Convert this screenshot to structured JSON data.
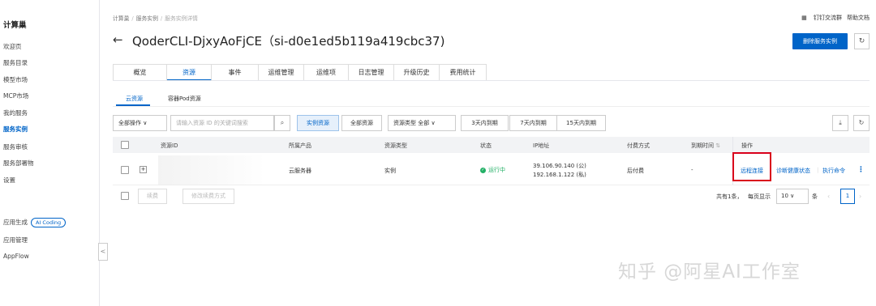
{
  "sidebar": {
    "brand": "计算巢",
    "items": [
      {
        "label": "欢迎页"
      },
      {
        "label": "服务目录"
      },
      {
        "label": "模型市场"
      },
      {
        "label": "MCP市场"
      },
      {
        "label": "我的服务"
      },
      {
        "label": "服务实例"
      },
      {
        "label": "服务审核"
      },
      {
        "label": "服务部署物"
      },
      {
        "label": "设置"
      }
    ],
    "group2": [
      {
        "label": "应用生成",
        "badge": "AI Coding"
      },
      {
        "label": "应用管理"
      },
      {
        "label": "AppFlow"
      }
    ],
    "collapse_glyph": "<"
  },
  "header": {
    "breadcrumb": [
      "计算巢",
      "服务实例",
      "服务实例详情"
    ],
    "links": [
      "钉钉交流群",
      "帮助文档"
    ],
    "title": "QoderCLI-DjxyAoFjCE（si-d0e1ed5b119a419cbc37)",
    "delete_button": "删除服务实例"
  },
  "tabs": [
    "概览",
    "资源",
    "事件",
    "运维管理",
    "运维项",
    "日志管理",
    "升级历史",
    "费用统计"
  ],
  "subtabs": [
    "云资源",
    "容器Pod资源"
  ],
  "filters": {
    "all_actions": "全部操作",
    "search_placeholder": "请输入资源 ID 的关键词搜索",
    "instance_resource": "实例资源",
    "all_resource": "全部资源",
    "resource_type": "资源类型  全部",
    "expire_3": "3天内到期",
    "expire_7": "7天内到期",
    "expire_15": "15天内到期"
  },
  "table": {
    "columns": [
      "资源ID",
      "所属产品",
      "资源类型",
      "状态",
      "IP地址",
      "付费方式",
      "到期时间",
      "操作"
    ],
    "row": {
      "product": "云服务器",
      "type": "实例",
      "status": "运行中",
      "ip_public": "39.106.90.140 (公)",
      "ip_private": "192.168.1.122 (私)",
      "billing": "后付费",
      "expire": "-",
      "actions": [
        "远程连接",
        "诊断健康状态",
        "执行命令"
      ]
    }
  },
  "footer": {
    "renew": "续费",
    "change_renew": "修改续费方式",
    "total": "共有1条，",
    "per_page_label": "每页显示",
    "per_page": "10",
    "unit": "条",
    "page": "1"
  },
  "watermark": "知乎 @阿星AI工作室",
  "colors": {
    "accent": "#0064c8",
    "success": "#23b066",
    "highlight": "#d9001b"
  }
}
